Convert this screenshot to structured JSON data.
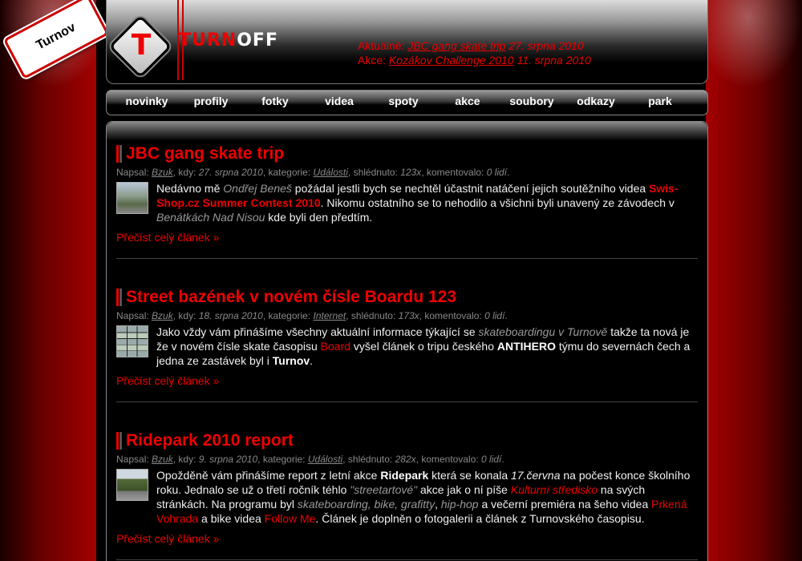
{
  "sign": {
    "town": "Turnov"
  },
  "logo": {
    "turn": "TURN",
    "off": "OFF"
  },
  "header": {
    "current_label": "Aktuálně:",
    "current_link": "JBC gang skate trip",
    "current_date": "27. srpna 2010",
    "event_label": "Akce:",
    "event_link": "Kozákov Challenge 2010",
    "event_date": "11. srpna 2010"
  },
  "nav": [
    "novinky",
    "profily",
    "fotky",
    "videa",
    "spoty",
    "akce",
    "soubory",
    "odkazy",
    "park"
  ],
  "meta_labels": {
    "author": "Napsal:",
    "when": "kdy:",
    "category": "kategorie:",
    "views": "shlédnuto:",
    "comments": "komentovalo:"
  },
  "read_more": "Přečíst celý článek »",
  "articles": [
    {
      "title": "JBC gang skate trip",
      "author": "Bzuk",
      "date": "27. srpna 2010",
      "category": "Události",
      "views": "123x",
      "comments": "0 lidí",
      "t1": "Nedávno mě ",
      "t2": "Ondřej Beneš",
      "t3": " požádal jestli bych se nechtěl účastnit natáčení jejich soutěžního videa ",
      "t4": "Swis-Shop.cz Summer Contest 2010",
      "t5": ". Nikomu ostatního se to nehodilo a všichni byli unavený ze závodech v ",
      "t6": "Benátkách Nad Nisou",
      "t7": " kde byli den předtím."
    },
    {
      "title": "Street bazének v novém čísle Boardu 123",
      "author": "Bzuk",
      "date": "18. srpna 2010",
      "category": "Internet",
      "views": "173x",
      "comments": "0 lidí",
      "t1": "Jako vždy vám přinášíme všechny aktuální informace týkající se ",
      "t2": "skateboardingu v Turnově",
      "t3": " takže ta nová je že v novém čísle skate časopisu ",
      "t4": "Board",
      "t5": " vyšel článek o tripu českého ",
      "t6": "ANTIHERO",
      "t7": " týmu do severnách čech a jedna ze zastávek byl i ",
      "t8": "Turnov",
      "t9": "."
    },
    {
      "title": "Ridepark 2010 report",
      "author": "Bzuk",
      "date": "9. srpna 2010",
      "category": "Události",
      "views": "282x",
      "comments": "0 lidí",
      "t1": "Opožděně vám přinášíme report z letní akce ",
      "t2": "Ridepark",
      "t3": " která se konala ",
      "t4": "17.června",
      "t5": " na počest konce školního roku. Jednalo se už o třetí ročník téhlo ",
      "t6": "\"streetartové\"",
      "t7": " akce jak o ní píše ",
      "t8": "Kulturní středisko",
      "t9": " na svých stránkách. Na programu byl ",
      "t10": "skateboarding, bike, grafitty",
      "t11": ", ",
      "t12": "hip-hop",
      "t13": " a večerní premiéra na šeho videa ",
      "t14": "Prkená Vohrada",
      "t15": " a bike videa ",
      "t16": "Follow Me",
      "t17": ". Článek je doplněn o fotogalerii a článek z Turnovského časopisu."
    }
  ]
}
